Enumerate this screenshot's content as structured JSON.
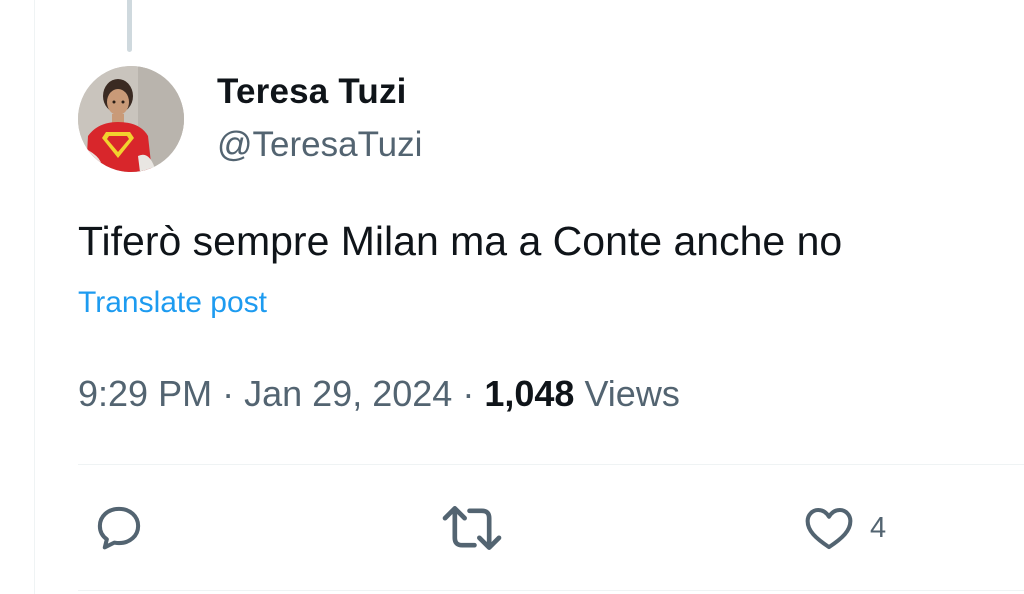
{
  "tweet": {
    "author": {
      "display_name": "Teresa Tuzi",
      "handle": "@TeresaTuzi"
    },
    "text": "Tiferò sempre Milan ma a Conte anche no",
    "translate_label": "Translate post",
    "time": "9:29 PM",
    "separator": "·",
    "date": "Jan 29, 2024",
    "views_count": "1,048",
    "views_label": "Views"
  },
  "actions": {
    "reply": {
      "icon": "reply-icon",
      "count": ""
    },
    "repost": {
      "icon": "repost-icon",
      "count": ""
    },
    "like": {
      "icon": "heart-icon",
      "count": "4"
    }
  },
  "colors": {
    "text_primary": "#0f1419",
    "text_secondary": "#536471",
    "link": "#1d9bf0",
    "border": "#eff3f4",
    "thread_line": "#cfd9de"
  }
}
